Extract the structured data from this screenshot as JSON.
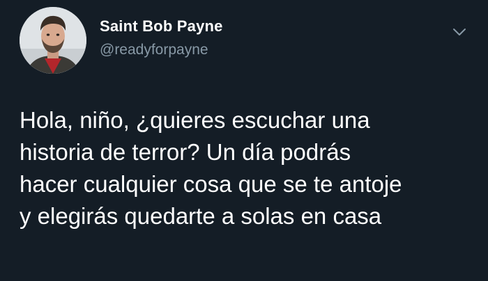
{
  "tweet": {
    "author": {
      "display_name": "Saint Bob Payne",
      "handle": "@readyforpayne",
      "avatar_icon": "profile-photo"
    },
    "menu_icon": "chevron-down-icon",
    "text_lines": [
      "Hola, niño, ¿quieres escuchar una",
      "historia de terror? Un día podrás",
      "hacer cualquier cosa que se te antoje",
      "y elegirás quedarte a solas en casa"
    ]
  },
  "colors": {
    "background": "#141d26",
    "text": "#ffffff",
    "secondary_text": "#8899a6"
  }
}
